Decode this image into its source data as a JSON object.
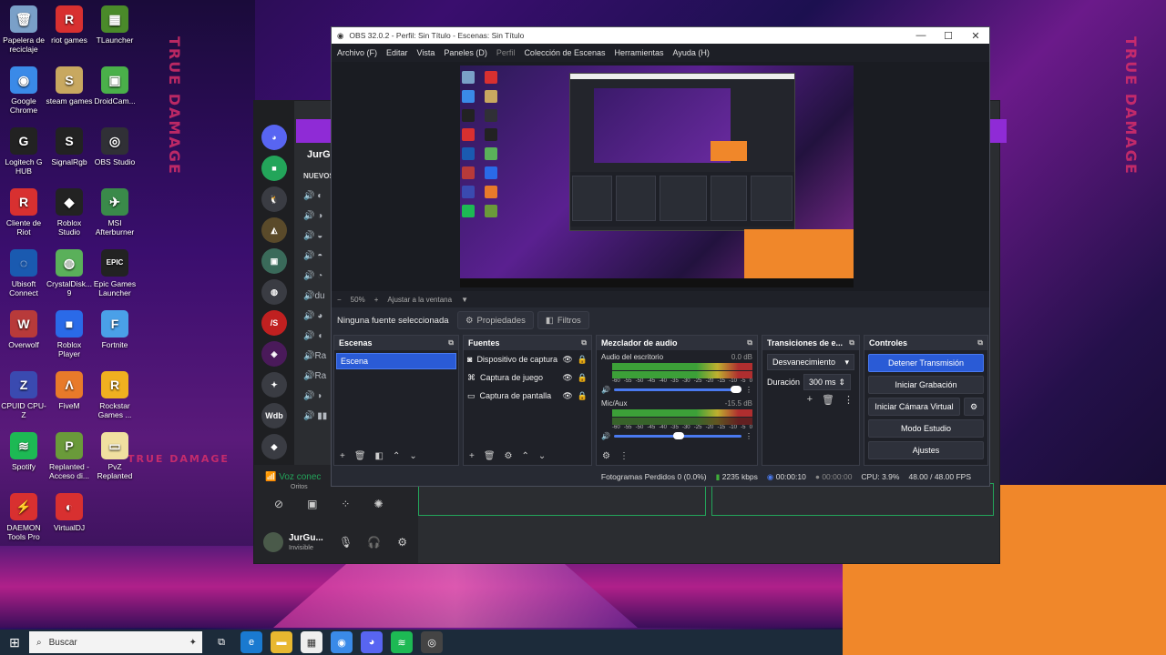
{
  "desktop": {
    "icons": [
      {
        "label": "Papelera de reciclaje",
        "glyph": "🗑",
        "color": "#7aa0c8"
      },
      {
        "label": "riot games",
        "glyph": "R",
        "color": "#d83030"
      },
      {
        "label": "TLauncher",
        "glyph": "▦",
        "color": "#4a8a2a"
      },
      {
        "label": "Google Chrome",
        "glyph": "◉",
        "color": "#3a8ae8"
      },
      {
        "label": "steam games",
        "glyph": "S",
        "color": "#c8a860"
      },
      {
        "label": "DroidCam...",
        "glyph": "▣",
        "color": "#4ab04a"
      },
      {
        "label": "Logitech G HUB",
        "glyph": "G",
        "color": "#222"
      },
      {
        "label": "SignalRgb",
        "glyph": "S",
        "color": "#222"
      },
      {
        "label": "OBS Studio",
        "glyph": "◎",
        "color": "#303036"
      },
      {
        "label": "Cliente de Riot",
        "glyph": "R",
        "color": "#d83030"
      },
      {
        "label": "Roblox Studio",
        "glyph": "◆",
        "color": "#222"
      },
      {
        "label": "MSI Afterburner",
        "glyph": "✈",
        "color": "#3a8a4a"
      },
      {
        "label": "Ubisoft Connect",
        "glyph": "◌",
        "color": "#1a5ab0"
      },
      {
        "label": "CrystalDisk... 9",
        "glyph": "◍",
        "color": "#5ab05a"
      },
      {
        "label": "Epic Games Launcher",
        "glyph": "EPIC",
        "color": "#222"
      },
      {
        "label": "Overwolf",
        "glyph": "W",
        "color": "#b83a3a"
      },
      {
        "label": "Roblox Player",
        "glyph": "■",
        "color": "#2a6ae8"
      },
      {
        "label": "Fortnite",
        "glyph": "F",
        "color": "#4aa0e8"
      },
      {
        "label": "CPUID CPU-Z",
        "glyph": "Z",
        "color": "#3a4ab0"
      },
      {
        "label": "FiveM",
        "glyph": "Λ",
        "color": "#e87a2a"
      },
      {
        "label": "Rockstar Games ...",
        "glyph": "R",
        "color": "#f0b020"
      },
      {
        "label": "Spotify",
        "glyph": "≋",
        "color": "#1db954"
      },
      {
        "label": "Replanted - Acceso di...",
        "glyph": "P",
        "color": "#6a9a3a"
      },
      {
        "label": "PvZ Replanted",
        "glyph": "▭",
        "color": "#f0e0a0"
      },
      {
        "label": "DAEMON Tools Pro",
        "glyph": "⚡",
        "color": "#d83030"
      },
      {
        "label": "VirtualDJ",
        "glyph": "◐",
        "color": "#d83030"
      }
    ],
    "wall_texts": [
      "TRUE DAMAGE",
      "TRUE DAMAGE",
      "TRUE DAMAGE"
    ]
  },
  "discord": {
    "server_name": "JurGu...",
    "section": "NUEVOS",
    "channel_du": "du",
    "channel_ra1": "Ra",
    "channel_ra2": "Ra",
    "voice_status": "Voz conec",
    "voice_sub": "Oritos",
    "user_name": "JurGu...",
    "user_status": "Invisible",
    "wdb": "Wdb"
  },
  "obs": {
    "title": "OBS 32.0.2 - Perfil: Sin Título - Escenas: Sin Título",
    "menu": [
      "Archivo (F)",
      "Editar",
      "Vista",
      "Paneles (D)",
      "Perfil",
      "Colección de Escenas",
      "Herramientas",
      "Ayuda (H)"
    ],
    "zoom": "50%",
    "fit_label": "Ajustar a la ventana",
    "no_source": "Ninguna fuente seleccionada",
    "properties": "Propiedades",
    "filters": "Filtros",
    "docks": {
      "scenes": "Escenas",
      "sources": "Fuentes",
      "mixer": "Mezclador de audio",
      "transitions": "Transiciones de e...",
      "controls": "Controles"
    },
    "scene_item": "Escena",
    "sources": [
      "Dispositivo de captura",
      "Captura de juego",
      "Captura de pantalla"
    ],
    "mixer_channels": [
      {
        "name": "Audio del escritorio",
        "db": "0.0 dB",
        "volume": 1.0
      },
      {
        "name": "Mic/Aux",
        "db": "-15.5 dB",
        "volume": 0.55
      }
    ],
    "scale": [
      "-60",
      "-55",
      "-50",
      "-45",
      "-40",
      "-35",
      "-30",
      "-25",
      "-20",
      "-15",
      "-10",
      "-5",
      "0"
    ],
    "transition": "Desvanecimiento",
    "duration_label": "Duración",
    "duration": "300 ms",
    "controls": {
      "stop_stream": "Detener Transmisión",
      "start_record": "Iniciar Grabación",
      "virtual_cam": "Iniciar Cámara Virtual",
      "studio_mode": "Modo Estudio",
      "settings": "Ajustes"
    },
    "status": {
      "dropped": "Fotogramas Perdidos 0 (0.0%)",
      "bitrate": "2235 kbps",
      "stream_time": "00:00:10",
      "rec_time": "00:00:00",
      "cpu": "CPU: 3.9%",
      "fps": "48.00 / 48.00 FPS"
    }
  },
  "taskbar": {
    "search_placeholder": "Buscar"
  },
  "colors": {
    "accent_blue": "#2a5bd6",
    "orange": "#f0872a",
    "obs_bg": "#272a33"
  }
}
